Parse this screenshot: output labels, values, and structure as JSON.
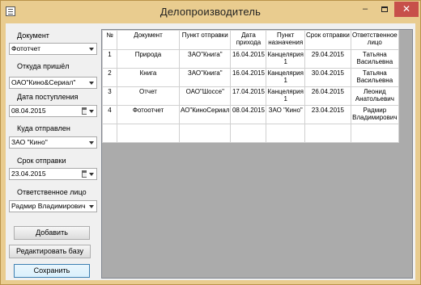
{
  "window": {
    "title": "Делопроизводитель",
    "controls": {
      "minimize": "–",
      "close": "✕"
    }
  },
  "form": {
    "document_label": "Документ",
    "document_value": "Фототчет",
    "from_label": "Откуда пришёл",
    "from_value": "ОАО\"Кино&Сериал\"",
    "date_in_label": "Дата поступления",
    "date_in_value": "08.04.2015",
    "to_label": "Куда отправлен",
    "to_value": "ЗАО \"Кино\"",
    "deadline_label": "Срок отправки",
    "deadline_value": "23.04.2015",
    "person_label": "Ответственное лицо",
    "person_value": "Радмир Владимирович",
    "add_button": "Добавить",
    "edit_button": "Редактировать базу",
    "save_button": "Сохранить"
  },
  "table": {
    "headers": [
      "№",
      "Документ",
      "Пункт отправки",
      "Дата прихода",
      "Пункт назначения",
      "Срок отправки",
      "Ответственное лицо"
    ],
    "rows": [
      [
        "1",
        "Природа",
        "ЗАО\"Книга\"",
        "16.04.2015",
        "Канцелярия 1",
        "29.04.2015",
        "Татьяна Васильевна"
      ],
      [
        "2",
        "Книга",
        "ЗАО\"Книга\"",
        "16.04.2015",
        "Канцелярия 1",
        "30.04.2015",
        "Татьяна Васильевна"
      ],
      [
        "3",
        "Отчет",
        "ОАО\"Шоссе\"",
        "17.04.2015",
        "Канцелярия 1",
        "26.04.2015",
        "Леонид Анатольевич"
      ],
      [
        "4",
        "Фотоотчет",
        "АО\"КиноСериал",
        "08.04.2015",
        "ЗАО \"Кино\"",
        "23.04.2015",
        "Радмир Владимирович"
      ]
    ]
  }
}
